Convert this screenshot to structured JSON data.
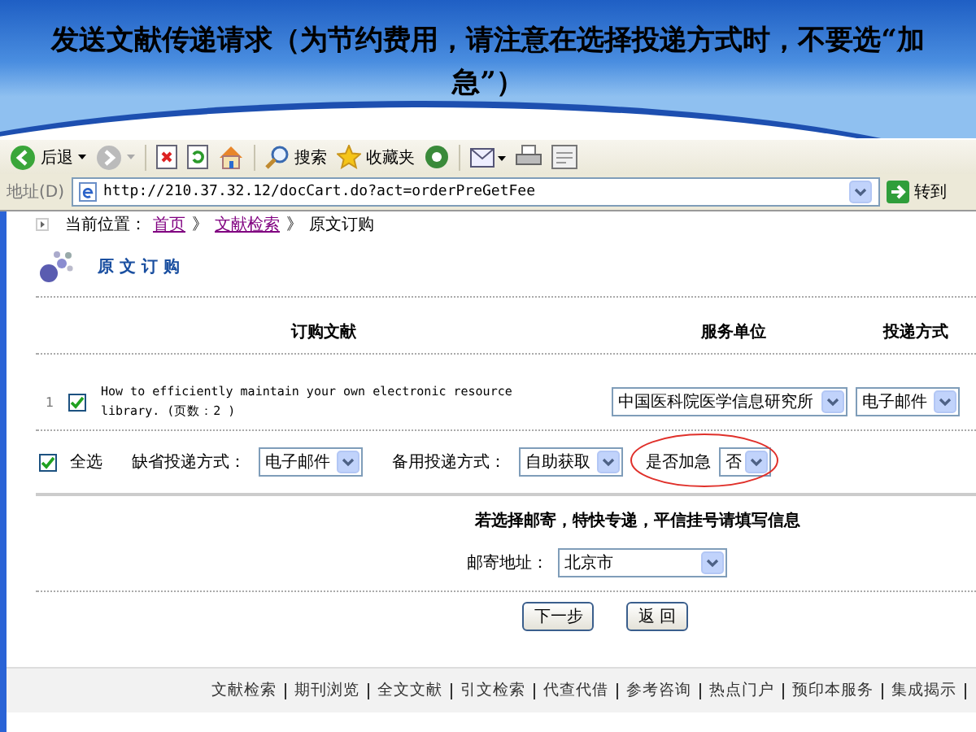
{
  "slide": {
    "title": "发送文献传递请求（为节约费用，请注意在选择投递方式时，不要选“加急”）"
  },
  "toolbar": {
    "items": [
      {
        "kind": "back",
        "label": "后退",
        "disabled": false
      },
      {
        "kind": "forward",
        "disabled": true
      },
      {
        "kind": "stop"
      },
      {
        "kind": "refresh"
      },
      {
        "kind": "home"
      },
      {
        "kind": "search",
        "label": "搜索"
      },
      {
        "kind": "favorites",
        "label": "收藏夹"
      },
      {
        "kind": "media"
      },
      {
        "kind": "mail"
      },
      {
        "kind": "print"
      },
      {
        "kind": "edit"
      }
    ]
  },
  "address_bar": {
    "label": "地址(D)",
    "url": "http://210.37.32.12/docCart.do?act=orderPreGetFee",
    "go_label": "转到"
  },
  "breadcrumb": {
    "prefix": "当前位置：",
    "links": [
      "首页",
      "文献检索"
    ],
    "separators": [
      "》",
      "》"
    ],
    "current": "原文订购"
  },
  "section_title": "原 文 订 购",
  "table": {
    "columns": [
      "订购文献",
      "服务单位",
      "投递方式"
    ],
    "rows": [
      {
        "index": "1",
        "checked": true,
        "title": "How to efficiently maintain your own electronic resource library. (页数：2 )",
        "provider": "中国医科院医学信息研究所",
        "delivery": "电子邮件"
      }
    ]
  },
  "options": {
    "select_all": {
      "label": "全选",
      "checked": true
    },
    "default_delivery": {
      "label": "缺省投递方式：",
      "value": "电子邮件"
    },
    "backup_delivery": {
      "label": "备用投递方式：",
      "value": "自助获取"
    },
    "urgent": {
      "label": "是否加急",
      "value": "否",
      "highlighted": true
    }
  },
  "mail_notice": "若选择邮寄，特快专递，平信挂号请填写信息",
  "mail_address": {
    "label": "邮寄地址：",
    "value": "北京市"
  },
  "buttons": [
    "下一步",
    "返 回"
  ],
  "footer_links": [
    "文献检索",
    "期刊浏览",
    "全文文献",
    "引文检索",
    "代查代借",
    "参考咨询",
    "热点门户",
    "预印本服务",
    "集成揭示"
  ]
}
